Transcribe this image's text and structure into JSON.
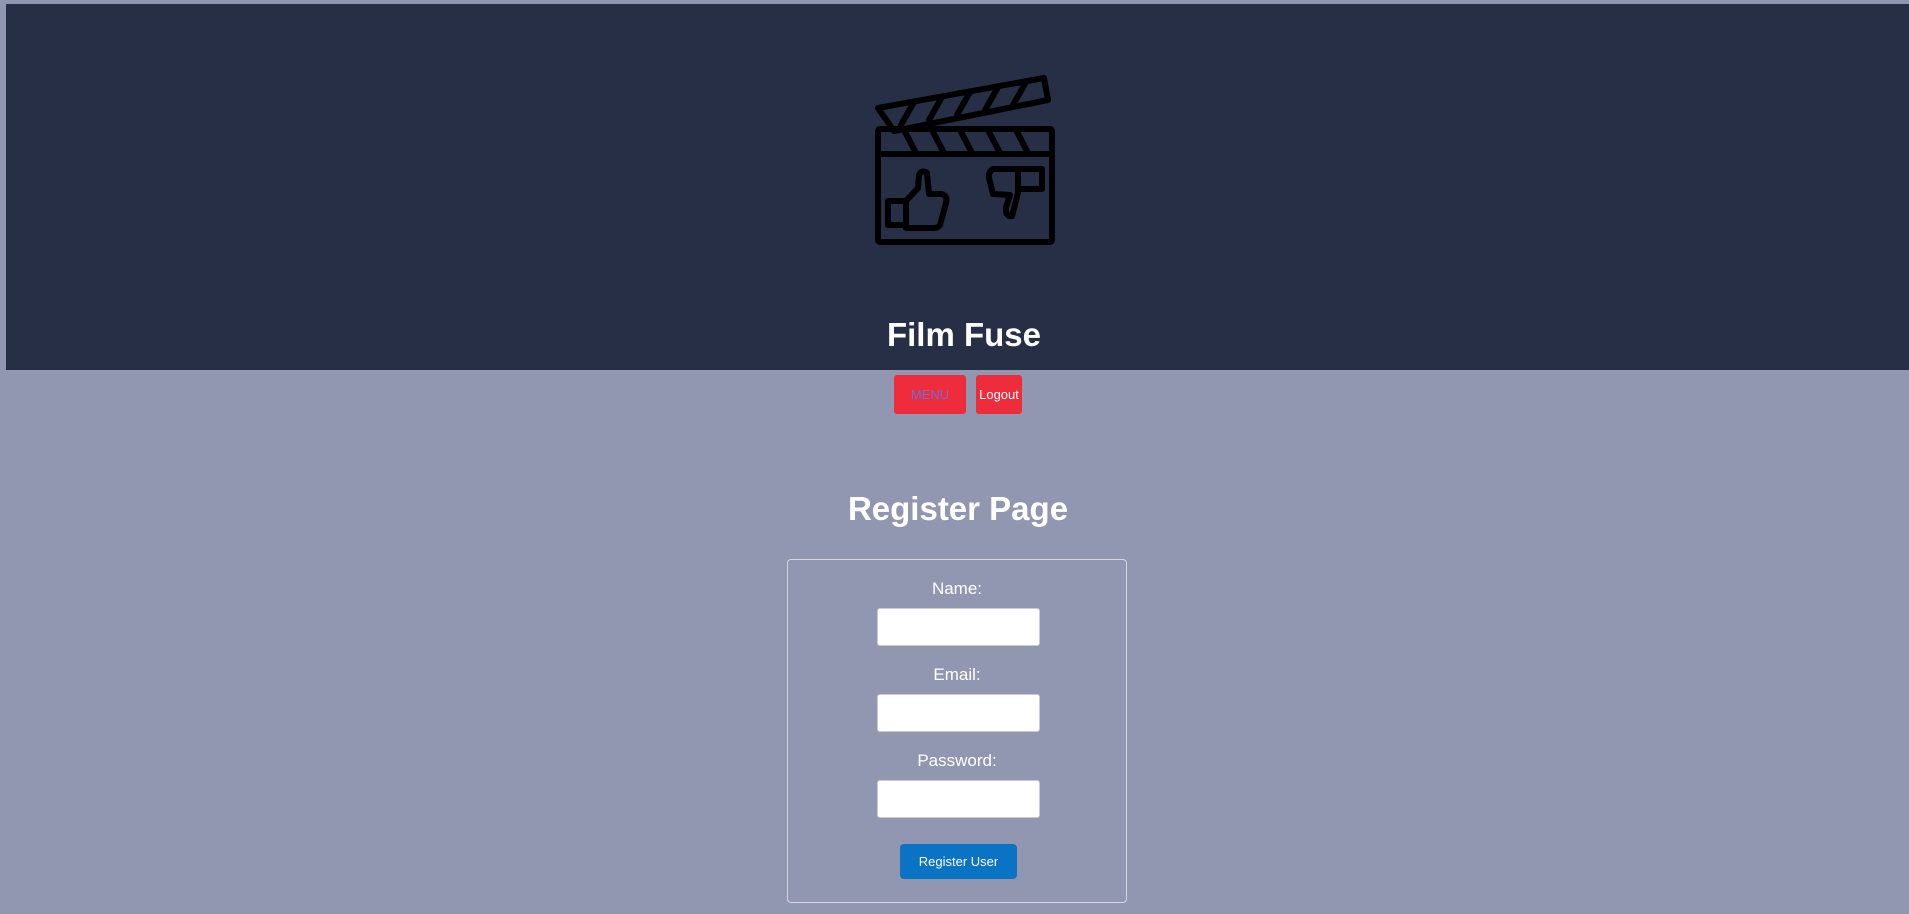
{
  "header": {
    "logo_icon": "clapperboard-thumbs-icon",
    "title": "Film Fuse"
  },
  "nav": {
    "menu_label": "MENU",
    "logout_label": "Logout"
  },
  "page": {
    "heading": "Register Page"
  },
  "form": {
    "name_label": "Name:",
    "name_value": "",
    "email_label": "Email:",
    "email_value": "",
    "password_label": "Password:",
    "password_value": "",
    "submit_label": "Register User"
  },
  "colors": {
    "page_background": "#9197b0",
    "header_background": "#262f45",
    "nav_button": "#ee2c3c",
    "submit_button": "#0b73c4"
  }
}
